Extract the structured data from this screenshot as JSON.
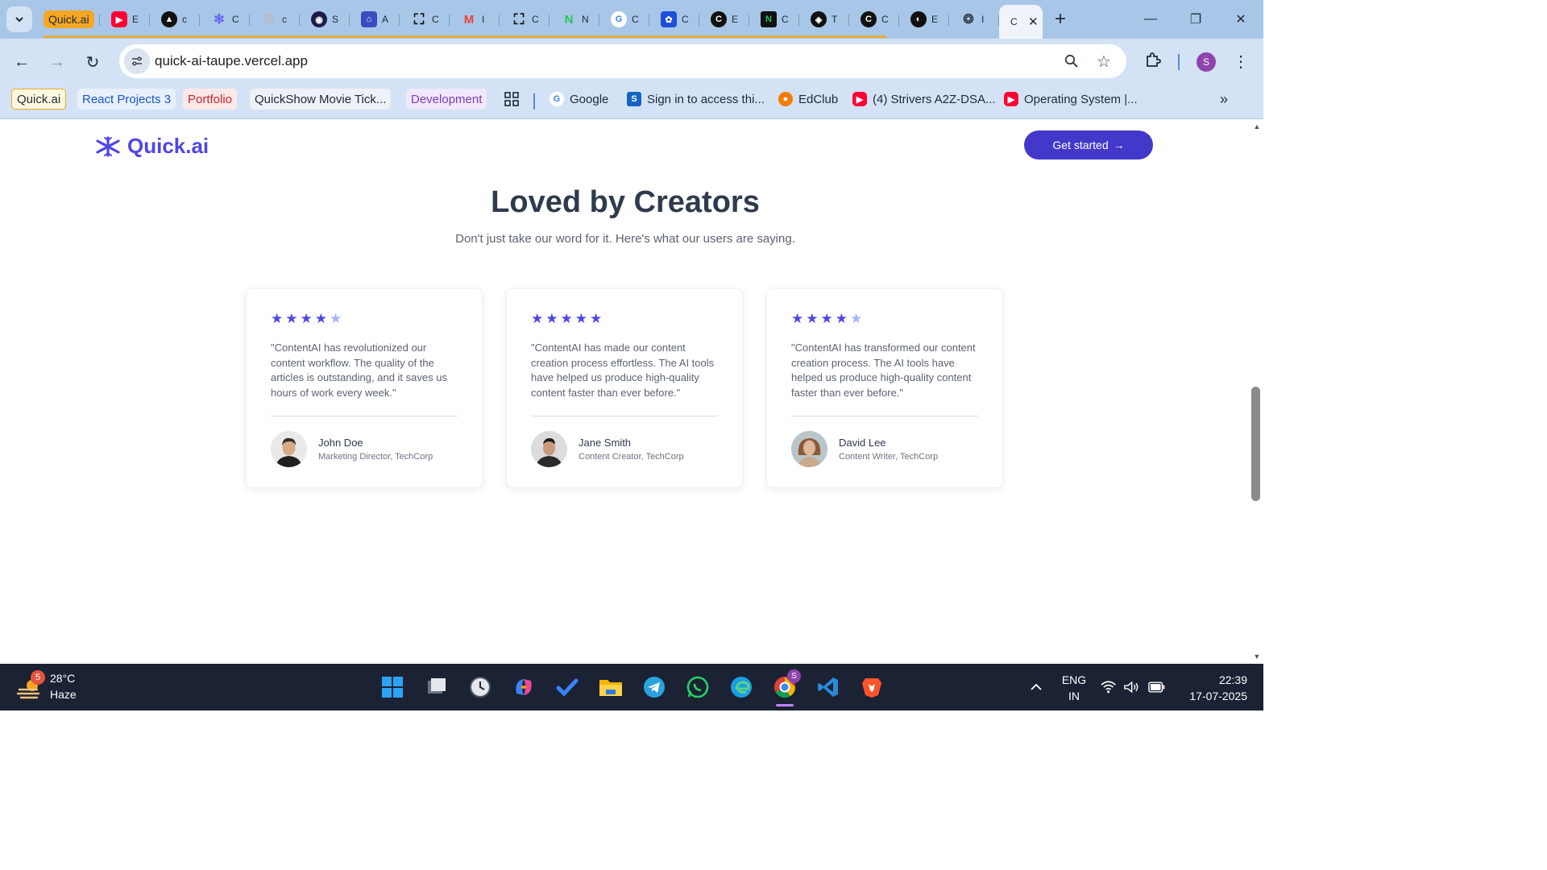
{
  "browser": {
    "first_tab_label": "Quick.ai",
    "tab_letters": [
      "E",
      "c",
      "C",
      "c",
      "S",
      "A",
      "C",
      "I",
      "C",
      "N",
      "C",
      "C",
      "E",
      "C",
      "T",
      "C",
      "E",
      "I",
      "C"
    ],
    "url": "quick-ai-taupe.vercel.app",
    "profile_initial": "S",
    "bookmarks": [
      "Quick.ai",
      "React Projects 3",
      "Portfolio",
      "QuickShow Movie Tick...",
      "Development",
      "Google",
      "Sign in to access thi...",
      "EdClub",
      "(4) Strivers A2Z-DSA...",
      "Operating System |..."
    ]
  },
  "site": {
    "logo_text": "Quick.ai",
    "cta_label": "Get started"
  },
  "section": {
    "heading": "Loved by Creators",
    "subheading": "Don't just take our word for it. Here's what our users are saying."
  },
  "testimonials": [
    {
      "rating": 4,
      "quote": "\"ContentAI has revolutionized our content workflow. The quality of the articles is outstanding, and it saves us hours of work every week.\"",
      "name": "John Doe",
      "role": "Marketing Director, TechCorp"
    },
    {
      "rating": 5,
      "quote": "\"ContentAI has made our content creation process effortless. The AI tools have helped us produce high-quality content faster than ever before.\"",
      "name": "Jane Smith",
      "role": "Content Creator, TechCorp"
    },
    {
      "rating": 4,
      "quote": "\"ContentAI has transformed our content creation process. The AI tools have helped us produce high-quality content faster than ever before.\"",
      "name": "David Lee",
      "role": "Content Writer, TechCorp"
    }
  ],
  "taskbar": {
    "weather_badge": "5",
    "temperature": "28°C",
    "condition": "Haze",
    "chrome_badge": "S",
    "lang_line1": "ENG",
    "lang_line2": "IN",
    "time": "22:39",
    "date": "17-07-2025"
  },
  "colors": {
    "accent": "#4f46e5",
    "accent_dark": "#4338ca",
    "star_dim": "#a5b4fc",
    "heading": "#2f3a4d"
  }
}
